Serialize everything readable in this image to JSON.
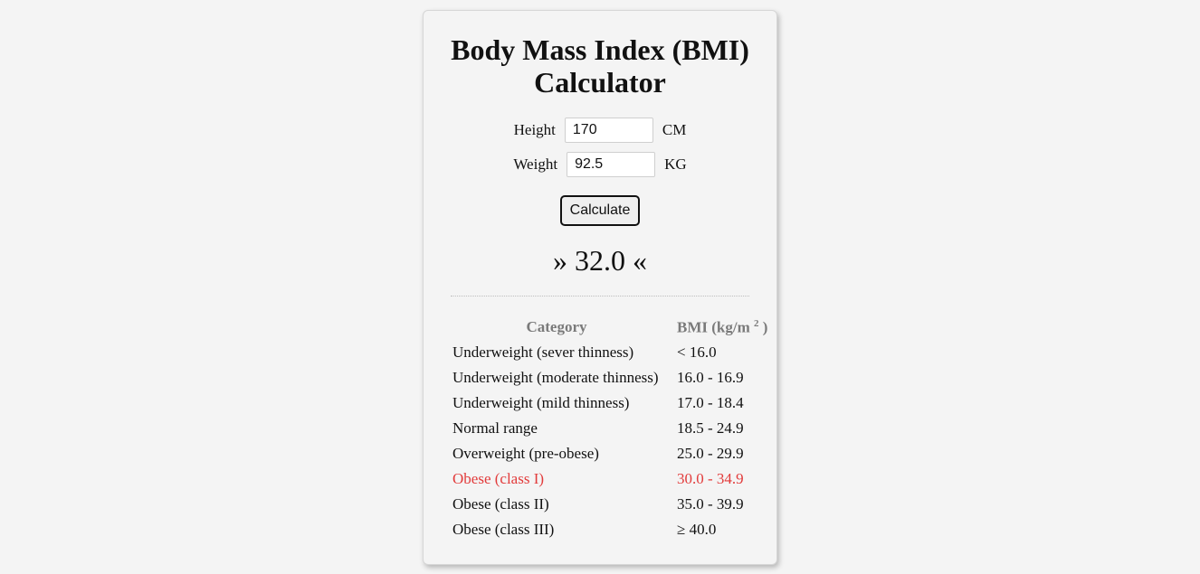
{
  "title": "Body Mass Index (BMI) Calculator",
  "form": {
    "height_label": "Height",
    "height_value": "170",
    "height_unit": "CM",
    "weight_label": "Weight",
    "weight_value": "92.5",
    "weight_unit": "KG",
    "calculate_label": "Calculate"
  },
  "result": "» 32.0 «",
  "table": {
    "col_category": "Category",
    "col_bmi": "BMI (kg/m",
    "col_bmi_sup": "2",
    "col_bmi_close": ")",
    "rows": [
      {
        "category": "Underweight (sever thinness)",
        "bmi": "< 16.0"
      },
      {
        "category": "Underweight (moderate thinness)",
        "bmi": "16.0 - 16.9"
      },
      {
        "category": "Underweight (mild thinness)",
        "bmi": "17.0 - 18.4"
      },
      {
        "category": "Normal range",
        "bmi": "18.5 - 24.9"
      },
      {
        "category": "Overweight (pre-obese)",
        "bmi": "25.0 - 29.9"
      },
      {
        "category": "Obese (class I)",
        "bmi": "30.0 - 34.9"
      },
      {
        "category": "Obese (class II)",
        "bmi": "35.0 - 39.9"
      },
      {
        "category": "Obese (class III)",
        "bmi": "≥ 40.0"
      }
    ],
    "highlight_row": 5,
    "highlight_color": "#e23b3b"
  }
}
